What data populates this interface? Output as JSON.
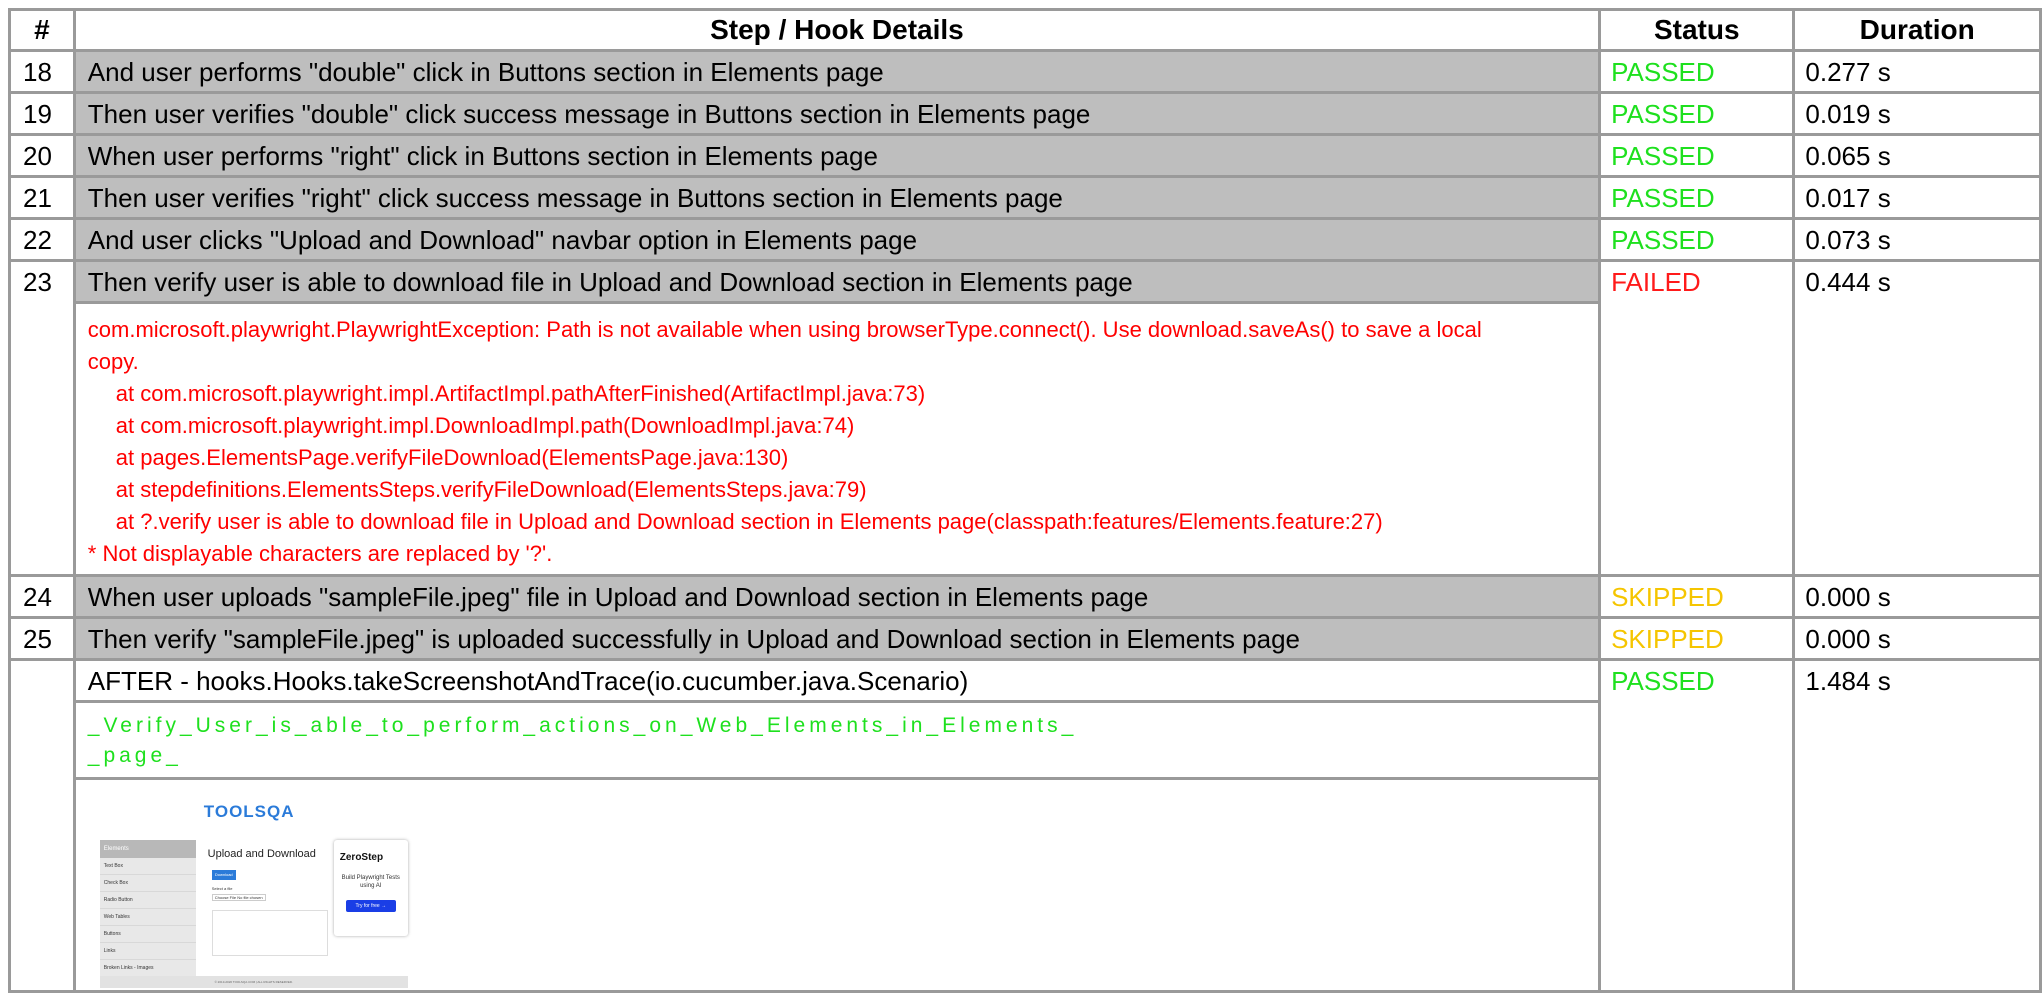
{
  "headers": {
    "num": "#",
    "details": "Step / Hook Details",
    "status": "Status",
    "duration": "Duration"
  },
  "rows": [
    {
      "num": "18",
      "details": "And user performs \"double\" click in Buttons section in Elements page",
      "status": "PASSED",
      "duration": "0.277 s"
    },
    {
      "num": "19",
      "details": "Then user verifies \"double\" click success message in Buttons section in Elements page",
      "status": "PASSED",
      "duration": "0.019 s"
    },
    {
      "num": "20",
      "details": "When user performs \"right\" click in Buttons section in Elements page",
      "status": "PASSED",
      "duration": "0.065 s"
    },
    {
      "num": "21",
      "details": "Then user verifies \"right\" click success message in Buttons section in Elements page",
      "status": "PASSED",
      "duration": "0.017 s"
    },
    {
      "num": "22",
      "details": "And user clicks \"Upload and Download\" navbar option in Elements page",
      "status": "PASSED",
      "duration": "0.073 s"
    },
    {
      "num": "23",
      "details": "Then verify user is able to download file in Upload and Download section in Elements page",
      "status": "FAILED",
      "duration": "0.444 s"
    },
    {
      "num": "24",
      "details": "When user uploads \"sampleFile.jpeg\" file in Upload and Download section in Elements page",
      "status": "SKIPPED",
      "duration": "0.000 s"
    },
    {
      "num": "25",
      "details": "Then verify \"sampleFile.jpeg\" is uploaded successfully in Upload and Download section in Elements page",
      "status": "SKIPPED",
      "duration": "0.000 s"
    },
    {
      "num": "",
      "details": "AFTER - hooks.Hooks.takeScreenshotAndTrace(io.cucumber.java.Scenario)",
      "status": "PASSED",
      "duration": "1.484 s"
    }
  ],
  "error": {
    "line1": "com.microsoft.playwright.PlaywrightException: Path is not available when using browserType.connect(). Use download.saveAs() to save a local",
    "line2": "copy.",
    "trace": [
      "at com.microsoft.playwright.impl.ArtifactImpl.pathAfterFinished(ArtifactImpl.java:73)",
      "at com.microsoft.playwright.impl.DownloadImpl.path(DownloadImpl.java:74)",
      "at pages.ElementsPage.verifyFileDownload(ElementsPage.java:130)",
      "at stepdefinitions.ElementsSteps.verifyFileDownload(ElementsSteps.java:79)",
      "at ?.verify user is able to download file in Upload and Download section in Elements page(classpath:features/Elements.feature:27)"
    ],
    "note": "* Not displayable characters are replaced by '?'."
  },
  "attachment_name_line1": "_Verify_User_is_able_to_perform_actions_on_Web_Elements_in_Elements_",
  "attachment_name_line2": "_page_",
  "thumbnail": {
    "logo": "TOOLSQA",
    "sidebar_header": "Elements",
    "sidebar_items": [
      "Text Box",
      "Check Box",
      "Radio Button",
      "Web Tables",
      "Buttons",
      "Links",
      "Broken Links - Images"
    ],
    "title": "Upload and Download",
    "download_button": "Download",
    "select_label": "Select a file",
    "choose_file": "Choose File  No file chosen",
    "ad_title": "ZeroStep",
    "ad_subtitle": "Build Playwright Tests using AI",
    "ad_button": "Try for free →",
    "footer": "© 2013-2020 TOOLSQA.COM | ALL RIGHTS RESERVED."
  },
  "colors": {
    "passed": "#1ee01e",
    "failed": "#ff1a1a",
    "skipped": "#f5c500",
    "step_bg": "#bebebe",
    "border": "#9a9a9a"
  }
}
